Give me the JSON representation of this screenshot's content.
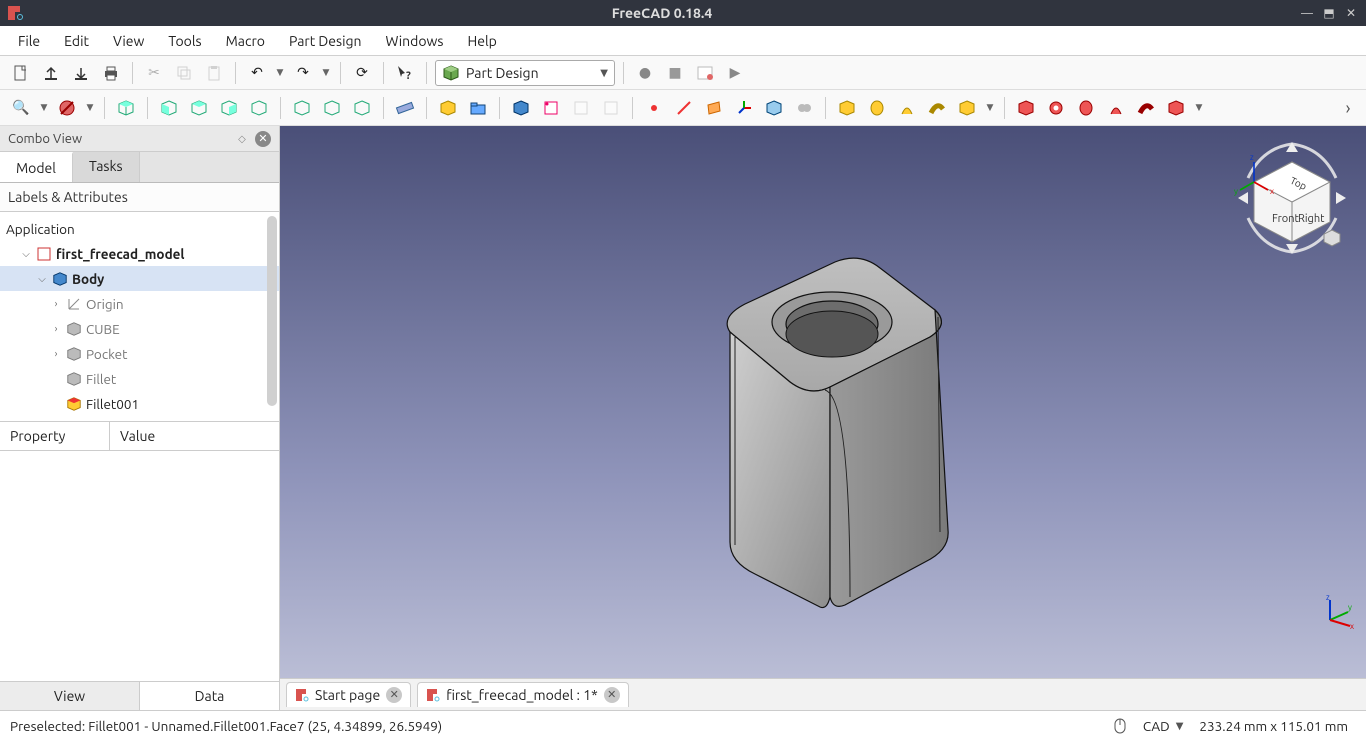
{
  "title": "FreeCAD 0.18.4",
  "menus": [
    "File",
    "Edit",
    "View",
    "Tools",
    "Macro",
    "Part Design",
    "Windows",
    "Help"
  ],
  "workbench": {
    "label": "Part Design"
  },
  "combo": {
    "title": "Combo View",
    "tabs": [
      "Model",
      "Tasks"
    ],
    "active_tab": 0,
    "subheader": "Labels & Attributes",
    "app_label": "Application",
    "tree": {
      "doc": "first_freecad_model",
      "body": "Body",
      "items": [
        "Origin",
        "CUBE",
        "Pocket",
        "Fillet",
        "Fillet001"
      ]
    },
    "props": {
      "col1": "Property",
      "col2": "Value"
    },
    "bottom_tabs": [
      "View",
      "Data"
    ]
  },
  "doc_tabs": [
    {
      "label": "Start page"
    },
    {
      "label": "first_freecad_model : 1*"
    }
  ],
  "status": {
    "left": "Preselected: Fillet001 - Unnamed.Fillet001.Face7 (25, 4.34899, 26.5949)",
    "mode": "CAD",
    "dims": "233.24 mm x 115.01 mm"
  },
  "navcube": {
    "front": "Front",
    "right": "Right",
    "top": "Top"
  }
}
